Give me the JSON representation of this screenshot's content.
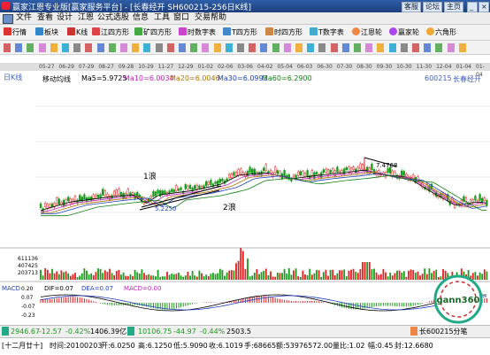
{
  "window": {
    "title": "赢家江恩专业版[赢家服务平台] - [长春经开 SH600215-256日K线]",
    "buttons": [
      "客服",
      "论坛",
      "主页"
    ]
  },
  "menu": [
    "文件",
    "查看",
    "设计",
    "江恩",
    "公式选股",
    "信息",
    "工具",
    "窗口",
    "交易帮助"
  ],
  "toolbar1": [
    "行情",
    "板块",
    "K线",
    "江四方形",
    "矿四方形",
    "时数字表",
    "T四方形",
    "时四方形",
    "T数字表",
    "江恩轮",
    "赢家轮",
    "六角形"
  ],
  "toolbar2_icons": [
    "arrow-icon",
    "cross-icon",
    "line-icon",
    "ray-icon",
    "channel-icon",
    "parallel-icon",
    "fib-icon",
    "circle-icon",
    "arc-icon",
    "fan-icon",
    "box-icon",
    "cycle-icon",
    "gann-icon",
    "angle-icon",
    "text-icon",
    "eraser-icon",
    "period-icon",
    "wave-icon",
    "speed-icon",
    "square-icon",
    "pitch-icon",
    "wedge-icon",
    "rect-icon",
    "ellipse-icon",
    "spiral-icon",
    "note-icon",
    "ruler-icon",
    "mark-icon",
    "flag-icon",
    "delete-icon",
    "zoom-in-icon",
    "zoom-out-icon",
    "left-icon",
    "right-icon",
    "up-icon",
    "down-icon",
    "home-icon",
    "end-icon",
    "refresh-icon",
    "help-icon"
  ],
  "dates": [
    "05-27",
    "06-29",
    "07-29",
    "08-27",
    "09-28",
    "10-29",
    "11-27",
    "12-29",
    "01-02",
    "02-06",
    "03-06",
    "04-02",
    "05-04",
    "06-03",
    "06-30",
    "07-30",
    "08-30",
    "09-30",
    "10-30",
    "11-30",
    "12-04",
    "01-04",
    "01-04"
  ],
  "info": {
    "period": "日K线",
    "indicator": "移动均线",
    "ma5": "Ma5=5.9725",
    "ma10": "Ma10=6.0034",
    "ma20": "Ma20=6.0046",
    "ma30": "Ma30=6.0993",
    "ma60": "Ma60=6.2900",
    "code": "600215",
    "name": "长春经开"
  },
  "annotations": {
    "wave1": "1浪",
    "wave2": "2浪",
    "low_price": "5.2250",
    "high_price": "7.4768"
  },
  "volume": {
    "labels": [
      "611136",
      "407425",
      "203713"
    ]
  },
  "macd": {
    "label": "MACD",
    "dif": "DIF=0.07",
    "dea": "DEA=0.07",
    "macd": "MACD=0.00",
    "scale": [
      "0.20",
      "0.07",
      "-0.07",
      "-0.23"
    ]
  },
  "watermark": "gann360",
  "status1": {
    "sh": "2946.67",
    "sh_chg": "-12.57",
    "sh_pct": "-0.42%",
    "sh_amt": "1406.39亿",
    "sz": "10106.75",
    "sz_chg": "-44.97",
    "sz_pct": "-0.44%",
    "sz_amt": "2503.5",
    "stock": "长600215分笔"
  },
  "status2": {
    "period": "[十二月廿十]",
    "time": "时间:20100203",
    "open": "开:6.0250",
    "high": "高:6.1250",
    "low": "低:5.9090",
    "close": "收:6.1019",
    "volume": "手:68665",
    "amount": "额:53976572.00",
    "ratio": "量比:1.02",
    "chg": "幅:0.45",
    "turn": "封:12.6680"
  },
  "colors": {
    "up": "#e02020",
    "down": "#1a9a1a",
    "ma5": "#000000",
    "ma10": "#c020c0",
    "ma20": "#b07000",
    "ma30": "#2040c0",
    "ma60": "#108010",
    "title_bg": "#1c3f7d"
  }
}
